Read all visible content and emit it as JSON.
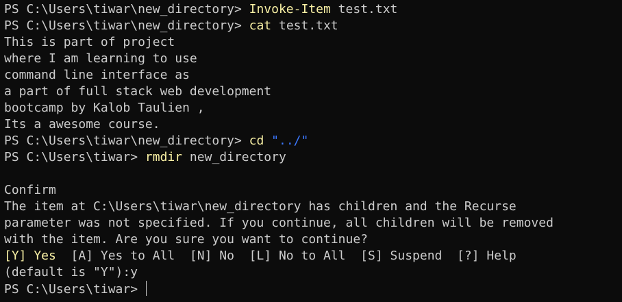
{
  "terminal": {
    "colors": {
      "background": "#0c0c0c",
      "foreground": "#cccccc",
      "command": "#f9f1a5",
      "string": "#3b78ff",
      "highlight": "#f9f1a5"
    },
    "lines": [
      {
        "prompt": "PS C:\\Users\\tiwar\\new_directory> ",
        "cmd": "Invoke-Item",
        "args": " test.txt"
      },
      {
        "prompt": "PS C:\\Users\\tiwar\\new_directory> ",
        "cmd": "cat",
        "args": " test.txt"
      },
      {
        "text": "This is part of project"
      },
      {
        "text": "where I am learning to use"
      },
      {
        "text": "command line interface as"
      },
      {
        "text": "a part of full stack web development"
      },
      {
        "text": "bootcamp by Kalob Taulien ,"
      },
      {
        "text": "Its a awesome course."
      },
      {
        "prompt": "PS C:\\Users\\tiwar\\new_directory> ",
        "cmd": "cd",
        "args": " ",
        "str": "\"../\""
      },
      {
        "prompt": "PS C:\\Users\\tiwar> ",
        "cmd": "rmdir",
        "args": " new_directory"
      },
      {
        "text": ""
      },
      {
        "text": "Confirm"
      },
      {
        "text": "The item at C:\\Users\\tiwar\\new_directory has children and the Recurse"
      },
      {
        "text": "parameter was not specified. If you continue, all children will be removed"
      },
      {
        "text": "with the item. Are you sure you want to continue?"
      },
      {
        "choices_default": "[Y] Yes",
        "choices_rest": "  [A] Yes to All  [N] No  [L] No to All  [S] Suspend  [?] Help"
      },
      {
        "text": "(default is \"Y\"):y"
      },
      {
        "prompt": "PS C:\\Users\\tiwar> "
      }
    ]
  }
}
